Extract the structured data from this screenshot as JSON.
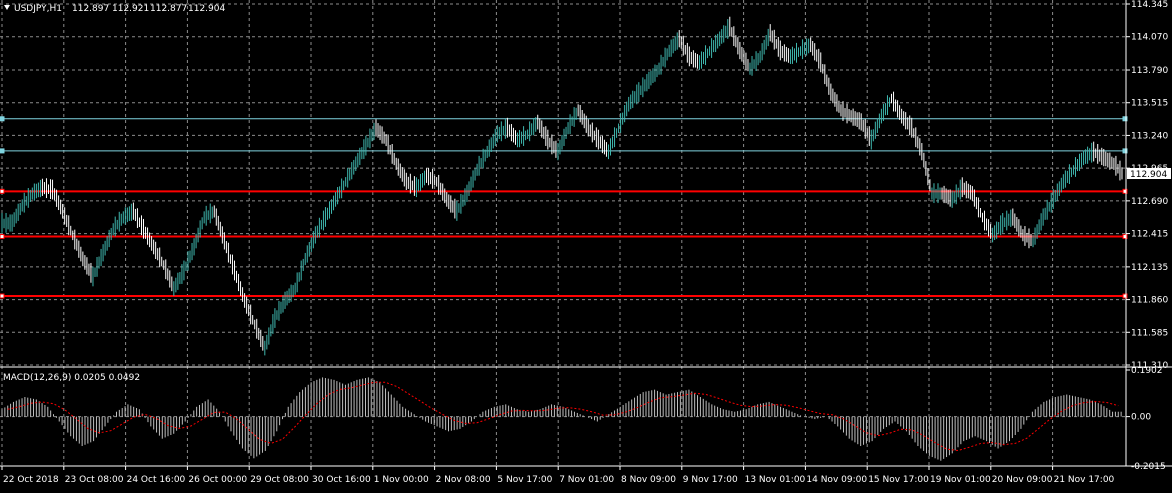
{
  "symbol_header": {
    "symbol": "USDJPY,H1",
    "open": "112.897",
    "high": "112.921",
    "low": "112.877",
    "close": "112.904",
    "current_price_label": "112.904"
  },
  "colors": {
    "background": "#000000",
    "grid": "#8c8c8c",
    "candle_up": "#3fb8af",
    "candle_down": "#ffffff",
    "level_line": "#ff0000",
    "channel_line": "#7fd4e0",
    "macd_histogram": "#c0c0c0",
    "macd_signal": "#ff0000",
    "axis_text": "#ffffff"
  },
  "chart_data": [
    {
      "type": "line",
      "title": "USDJPY,H1 112.897 112.921 112.877 112.904",
      "y_ticks": [
        "114.345",
        "114.070",
        "113.790",
        "113.515",
        "113.240",
        "112.965",
        "112.690",
        "112.415",
        "112.135",
        "111.860",
        "111.585",
        "111.310"
      ],
      "ylim": [
        111.31,
        114.345
      ],
      "x_ticks": [
        "22 Oct 2018",
        "23 Oct 08:00",
        "24 Oct 16:00",
        "26 Oct 00:00",
        "29 Oct 08:00",
        "30 Oct 16:00",
        "1 Nov 00:00",
        "2 Nov 08:00",
        "5 Nov 17:00",
        "7 Nov 01:00",
        "8 Nov 09:00",
        "9 Nov 17:00",
        "13 Nov 01:00",
        "14 Nov 09:00",
        "15 Nov 17:00",
        "19 Nov 01:00",
        "20 Nov 09:00",
        "21 Nov 17:00"
      ],
      "grid": true,
      "series": [
        {
          "values": [
            112.5,
            112.65,
            112.75,
            112.8,
            112.78,
            112.6,
            112.4,
            112.2,
            112.05,
            112.25,
            112.45,
            112.55,
            112.6,
            112.45,
            112.3,
            112.15,
            111.95,
            112.1,
            112.3,
            112.55,
            112.6,
            112.35,
            112.1,
            111.85,
            111.65,
            111.45,
            111.7,
            111.85,
            111.95,
            112.2,
            112.4,
            112.55,
            112.7,
            112.85,
            113.0,
            113.15,
            113.3,
            113.2,
            113.0,
            112.85,
            112.8,
            112.9,
            112.85,
            112.7,
            112.6,
            112.75,
            112.95,
            113.1,
            113.25,
            113.3,
            113.2,
            113.25,
            113.35,
            113.2,
            113.1,
            113.3,
            113.45,
            113.3,
            113.2,
            113.1,
            113.3,
            113.5,
            113.6,
            113.7,
            113.8,
            113.95,
            114.05,
            113.9,
            113.85,
            113.95,
            114.05,
            114.15,
            113.95,
            113.8,
            113.9,
            114.1,
            113.95,
            113.9,
            113.95,
            114.0,
            113.85,
            113.6,
            113.45,
            113.4,
            113.35,
            113.2,
            113.4,
            113.55,
            113.4,
            113.3,
            113.1,
            112.75,
            112.75,
            112.7,
            112.8,
            112.75,
            112.55,
            112.4,
            112.5,
            112.55,
            112.4,
            112.35,
            112.55,
            112.7,
            112.85,
            112.95,
            113.05,
            113.1,
            113.05,
            113.0,
            112.9
          ]
        }
      ],
      "horizontal_levels": [
        {
          "value": 113.38,
          "color": "#7fd4e0"
        },
        {
          "value": 113.11,
          "color": "#7fd4e0"
        },
        {
          "value": 112.77,
          "color": "#ff0000"
        },
        {
          "value": 112.39,
          "color": "#ff0000"
        },
        {
          "value": 111.89,
          "color": "#ff0000"
        }
      ]
    },
    {
      "type": "bar",
      "title": "MACD(12,26,9) 0.0205 0.0492",
      "y_ticks": [
        "0.1902",
        "0.00",
        "-0.2015"
      ],
      "ylim": [
        -0.2015,
        0.1902
      ],
      "series": [
        {
          "name": "MACD",
          "values": [
            0.03,
            0.06,
            0.08,
            0.07,
            0.04,
            -0.02,
            -0.08,
            -0.12,
            -0.1,
            -0.04,
            0.02,
            0.05,
            0.03,
            -0.04,
            -0.09,
            -0.07,
            -0.02,
            0.04,
            0.07,
            0.02,
            -0.06,
            -0.13,
            -0.17,
            -0.14,
            -0.06,
            0.04,
            0.1,
            0.14,
            0.16,
            0.15,
            0.13,
            0.15,
            0.16,
            0.14,
            0.09,
            0.04,
            0.01,
            -0.02,
            -0.04,
            -0.06,
            -0.05,
            -0.02,
            0.02,
            0.04,
            0.05,
            0.03,
            0.02,
            0.03,
            0.05,
            0.04,
            0.02,
            0.0,
            -0.02,
            0.01,
            0.04,
            0.07,
            0.1,
            0.11,
            0.09,
            0.1,
            0.11,
            0.08,
            0.05,
            0.03,
            0.02,
            0.03,
            0.05,
            0.06,
            0.04,
            0.02,
            0.0,
            -0.01,
            0.0,
            -0.04,
            -0.09,
            -0.12,
            -0.1,
            -0.05,
            -0.02,
            -0.06,
            -0.12,
            -0.16,
            -0.18,
            -0.15,
            -0.1,
            -0.08,
            -0.1,
            -0.13,
            -0.1,
            -0.05,
            0.02,
            0.06,
            0.08,
            0.09,
            0.08,
            0.07,
            0.05,
            0.02
          ]
        }
      ]
    }
  ]
}
